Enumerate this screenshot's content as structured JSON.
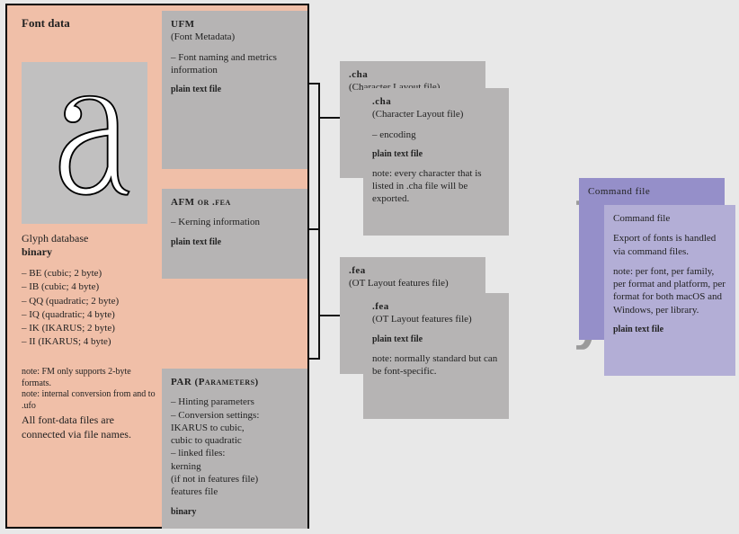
{
  "fontData": {
    "title": "Font data",
    "glyphLabel": "Glyph database",
    "glyphBinary": "binary",
    "formats": [
      "– BE (cubic; 2 byte)",
      "– IB (cubic; 4 byte)",
      "– QQ (quadratic; 2 byte)",
      "– IQ (quadratic; 4 byte)",
      "– IK (IKARUS; 2 byte)",
      "– II (IKARUS; 4 byte)"
    ],
    "note1": "note: FM only supports 2-byte formats.",
    "note2": "note: internal conversion from and to .ufo",
    "connected": "All font-data files are connected via file names."
  },
  "ufm": {
    "title": "UFM",
    "subtitle": "(Font Metadata)",
    "desc": "– Font naming and metrics information",
    "ptf": "plain text file"
  },
  "afm": {
    "title": "AFM  or .fea",
    "desc": "– Kerning information",
    "ptf": "plain text file"
  },
  "par": {
    "title": "PAR (Parameters)",
    "l1": "– Hinting parameters",
    "l2": "– Conversion settings:",
    "l3": "IKARUS to cubic,",
    "l4": "cubic to quadratic",
    "l5": "– linked files:",
    "l6": "kerning",
    "l7": "(if not in features file)",
    "l8": "features file",
    "binary": "binary"
  },
  "chaBack": {
    "title": ".cha",
    "subtitle": "(Character Layout file)"
  },
  "chaFront": {
    "title": ".cha",
    "subtitle": "(Character Layout file)",
    "desc": "– encoding",
    "ptf": "plain text file",
    "note": "note: every character that is listed in .cha file will be exported."
  },
  "feaBack": {
    "title": ".fea",
    "subtitle": "(OT Layout  features file)"
  },
  "feaFront": {
    "title": ".fea",
    "subtitle": "(OT Layout  features file)",
    "ptf": "plain text file",
    "note": "note: normally standard but can be font-specific."
  },
  "cmdBack": {
    "title": "Command file"
  },
  "cmdFront": {
    "title": "Command file",
    "desc": "Export of fonts is handled via command files.",
    "note": "note: per font, per family, per format and platform,  per format for both macOS and Windows, per library.",
    "ptf": "plain text file"
  }
}
